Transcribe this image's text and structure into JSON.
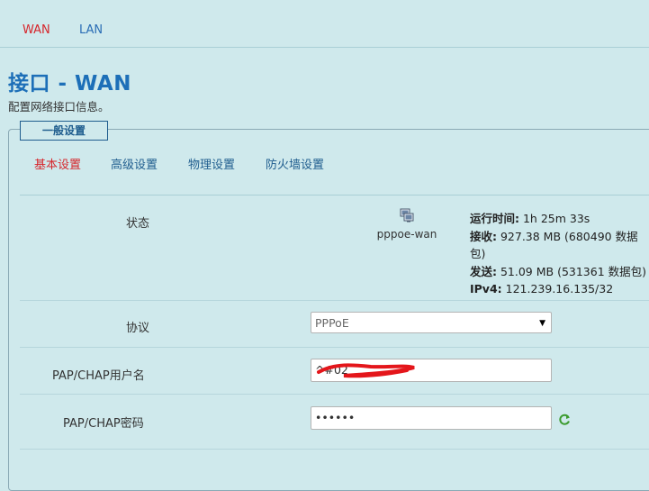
{
  "top_tabs": {
    "wan": "WAN",
    "lan": "LAN"
  },
  "page": {
    "title": "接口 - WAN",
    "description": "配置网络接口信息。"
  },
  "section": {
    "legend": "一般设置"
  },
  "subtabs": {
    "basic": "基本设置",
    "advanced": "高级设置",
    "physical": "物理设置",
    "firewall": "防火墙设置"
  },
  "status": {
    "label": "状态",
    "interface_name": "pppoe-wan",
    "uptime_label": "运行时间:",
    "uptime_value": " 1h 25m 33s",
    "rx_label": "接收:",
    "rx_value": " 927.38 MB (680490 数据包)",
    "tx_label": "发送:",
    "tx_value": " 51.09 MB (531361 数据包)",
    "ipv4_label": "IPv4:",
    "ipv4_value": " 121.239.16.135/32"
  },
  "protocol": {
    "label": "协议",
    "selected": "PPPoE"
  },
  "username": {
    "label": "PAP/CHAP用户名",
    "value": "^#02"
  },
  "password": {
    "label": "PAP/CHAP密码",
    "value": "••••••"
  },
  "colors": {
    "background": "#cfe9ec",
    "accent_red": "#d6262c",
    "accent_blue": "#1d6fb8"
  },
  "icons": {
    "interface": "network-interface-icon",
    "refresh": "refresh-icon",
    "dropdown": "chevron-down-icon"
  }
}
